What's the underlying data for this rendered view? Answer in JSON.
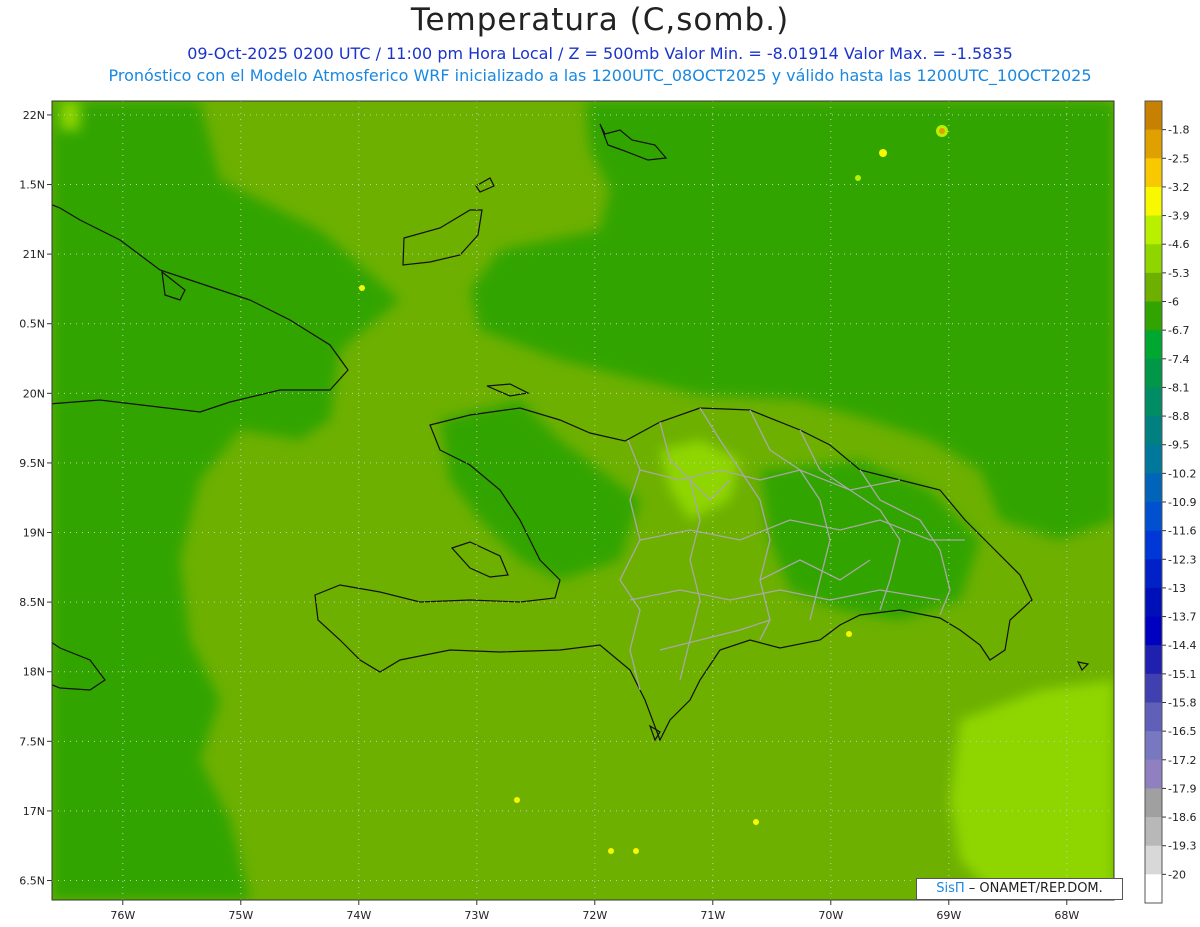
{
  "title": "Temperatura (C,somb.)",
  "subtitle1": "09-Oct-2025  0200 UTC / 11:00 pm Hora Local / Z = 500mb  Valor Min. = -8.01914  Valor Max. = -1.5835",
  "subtitle2": "Pronóstico con el Modelo Atmosferico WRF inicializado a las 1200UTC_08OCT2025 y válido hasta las  1200UTC_10OCT2025",
  "credit": {
    "brand": "SisΠ",
    "text": "– ONAMET/REP.DOM."
  },
  "colors": {
    "subtitle1": "#1a33cc",
    "subtitle2": "#1a88e0",
    "field_base": "#6db000",
    "field_dark": "#32a400",
    "field_light": "#8fd600"
  },
  "map": {
    "lon_range": [
      -76.6,
      -67.6
    ],
    "lat_range": [
      16.36,
      22.1
    ],
    "lon_ticks": [
      {
        "value": -76,
        "label": "76W"
      },
      {
        "value": -75,
        "label": "75W"
      },
      {
        "value": -74,
        "label": "74W"
      },
      {
        "value": -73,
        "label": "73W"
      },
      {
        "value": -72,
        "label": "72W"
      },
      {
        "value": -71,
        "label": "71W"
      },
      {
        "value": -70,
        "label": "70W"
      },
      {
        "value": -69,
        "label": "69W"
      },
      {
        "value": -68,
        "label": "68W"
      }
    ],
    "lat_ticks": [
      {
        "value": 22,
        "label": "22N"
      },
      {
        "value": 21.5,
        "label": "1.5N"
      },
      {
        "value": 21,
        "label": "21N"
      },
      {
        "value": 20.5,
        "label": "0.5N"
      },
      {
        "value": 20,
        "label": "20N"
      },
      {
        "value": 19.5,
        "label": "9.5N"
      },
      {
        "value": 19,
        "label": "19N"
      },
      {
        "value": 18.5,
        "label": "8.5N"
      },
      {
        "value": 18,
        "label": "18N"
      },
      {
        "value": 17.5,
        "label": "7.5N"
      },
      {
        "value": 17,
        "label": "17N"
      },
      {
        "value": 16.5,
        "label": "6.5N"
      }
    ]
  },
  "legend": [
    {
      "label": "-1.8",
      "color": "#c88000"
    },
    {
      "label": "-2.5",
      "color": "#e0a000"
    },
    {
      "label": "-3.2",
      "color": "#f8c800"
    },
    {
      "label": "-3.9",
      "color": "#f8f800"
    },
    {
      "label": "-4.6",
      "color": "#b8f000"
    },
    {
      "label": "-5.3",
      "color": "#8fd600"
    },
    {
      "label": "-6",
      "color": "#6db000"
    },
    {
      "label": "-6.7",
      "color": "#32a400"
    },
    {
      "label": "-7.4",
      "color": "#00a830"
    },
    {
      "label": "-8.1",
      "color": "#009848"
    },
    {
      "label": "-8.8",
      "color": "#008c64"
    },
    {
      "label": "-9.5",
      "color": "#008080"
    },
    {
      "label": "-10.2",
      "color": "#00789c"
    },
    {
      "label": "-10.9",
      "color": "#0064b8"
    },
    {
      "label": "-11.6",
      "color": "#0050d0"
    },
    {
      "label": "-12.3",
      "color": "#0038d8"
    },
    {
      "label": "-13",
      "color": "#0020c8"
    },
    {
      "label": "-13.7",
      "color": "#0010b8"
    },
    {
      "label": "-14.4",
      "color": "#0000c0"
    },
    {
      "label": "-15.1",
      "color": "#2020b0"
    },
    {
      "label": "-15.8",
      "color": "#4040b0"
    },
    {
      "label": "-16.5",
      "color": "#6060b8"
    },
    {
      "label": "-17.2",
      "color": "#7878c0"
    },
    {
      "label": "-17.9",
      "color": "#9080c0"
    },
    {
      "label": "-18.6",
      "color": "#a0a0a0"
    },
    {
      "label": "-19.3",
      "color": "#b8b8b8"
    },
    {
      "label": "-20",
      "color": "#d8d8d8"
    },
    {
      "label": "",
      "color": "#ffffff"
    }
  ]
}
